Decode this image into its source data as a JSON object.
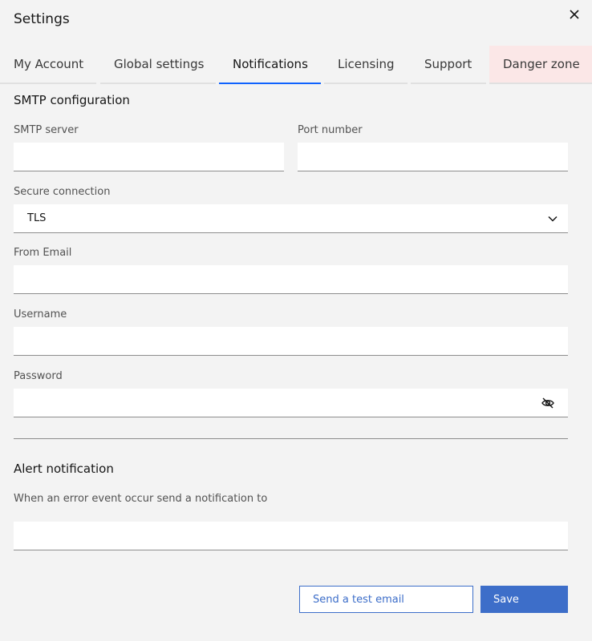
{
  "window": {
    "title": "Settings",
    "close_icon": "close-icon"
  },
  "tabs": [
    {
      "label": "My Account"
    },
    {
      "label": "Global settings"
    },
    {
      "label": "Notifications",
      "active": true
    },
    {
      "label": "Licensing"
    },
    {
      "label": "Support"
    },
    {
      "label": "Danger zone"
    }
  ],
  "smtp": {
    "section_title": "SMTP configuration",
    "server_label": "SMTP server",
    "server_value": "",
    "port_label": "Port number",
    "port_value": "",
    "secure_label": "Secure connection",
    "secure_value": "TLS",
    "from_label": "From Email",
    "from_value": "",
    "username_label": "Username",
    "username_value": "",
    "password_label": "Password",
    "password_value": ""
  },
  "alert": {
    "section_title": "Alert notification",
    "description": "When an error event occur send a notification to",
    "recipient_value": ""
  },
  "actions": {
    "test_label": "Send a test email",
    "save_label": "Save"
  },
  "colors": {
    "accent": "#3d6ec9",
    "active_tab": "#0f62fe",
    "danger_tab_bg": "#fbe7e7",
    "background": "#f3f3f3"
  }
}
